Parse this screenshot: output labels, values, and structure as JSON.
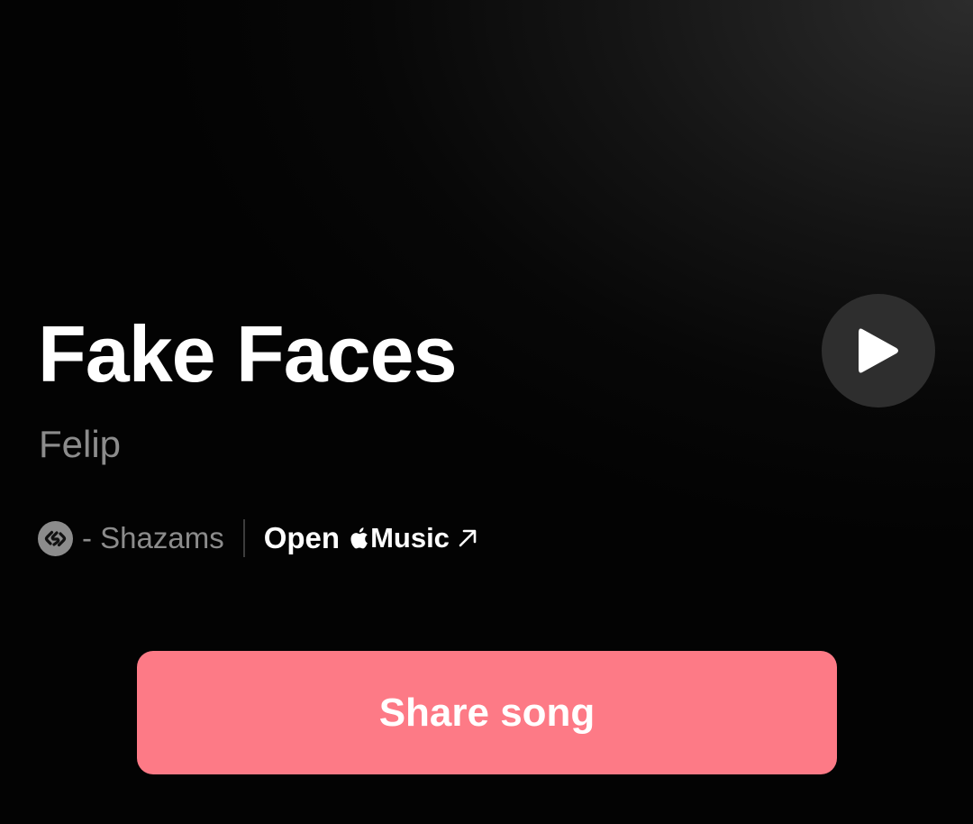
{
  "song": {
    "title": "Fake Faces",
    "artist": "Felip"
  },
  "meta": {
    "shazam_icon": "shazam-logo-icon",
    "shazams_text": "- Shazams",
    "open_label": "Open",
    "apple_icon": "apple-logo-icon",
    "music_label": "Music",
    "external_icon": "arrow-up-right-icon"
  },
  "player": {
    "play_icon": "play-icon"
  },
  "actions": {
    "share_label": "Share song"
  },
  "colors": {
    "background": "#000000",
    "share_button": "#fd7a86",
    "play_button": "#2e2e2e",
    "secondary_text": "#8c8c8c"
  }
}
